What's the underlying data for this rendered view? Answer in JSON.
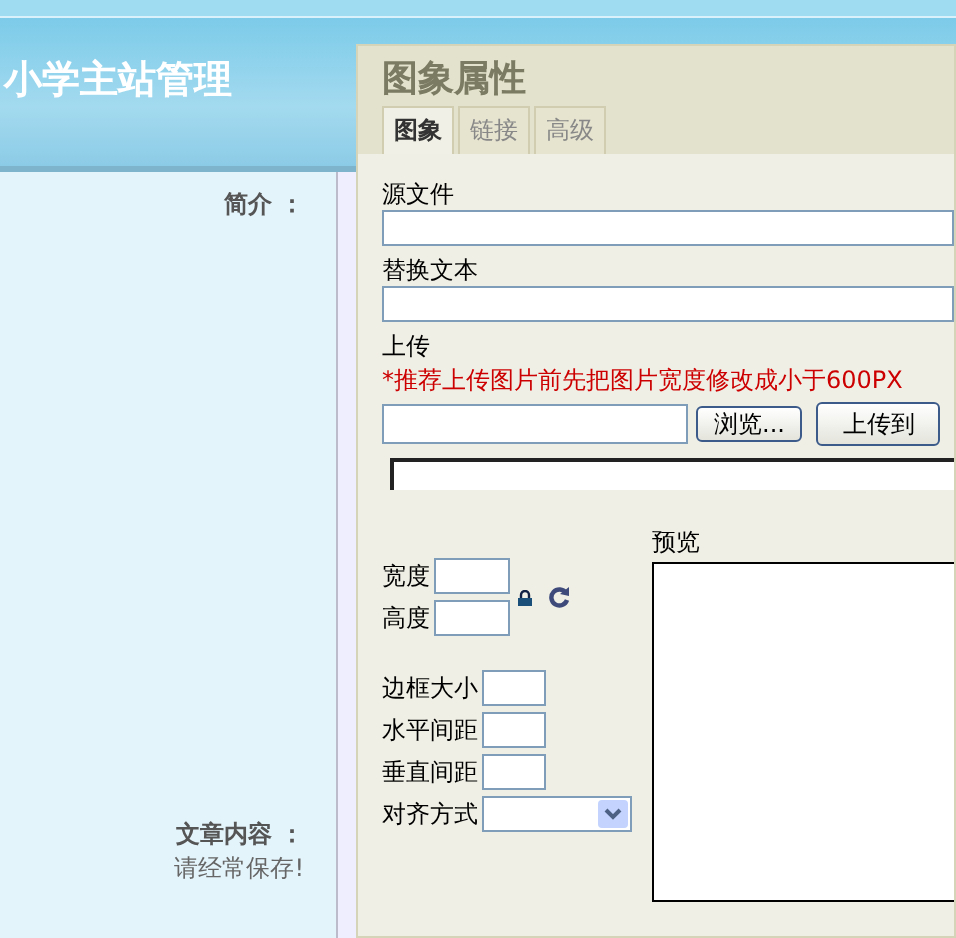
{
  "page": {
    "title": "小学主站管理",
    "fields": [
      {
        "label": "简介 ："
      },
      {
        "label": "文章内容 ：",
        "note": "请经常保存!"
      }
    ]
  },
  "dialog": {
    "title": "图象属性",
    "tabs": [
      {
        "label": "图象",
        "selected": true
      },
      {
        "label": "链接",
        "selected": false
      },
      {
        "label": "高级",
        "selected": false
      }
    ],
    "source_label": "源文件",
    "alt_label": "替换文本",
    "upload_label": "上传",
    "upload_hint": "*推荐上传图片前先把图片宽度修改成小于600PX",
    "browse_button": "浏览...",
    "upload_button": "上传到",
    "width_label": "宽度",
    "height_label": "高度",
    "spacing_fields": [
      {
        "label": "边框大小"
      },
      {
        "label": "水平间距"
      },
      {
        "label": "垂直间距"
      }
    ],
    "align_label": "对齐方式",
    "preview_label": "预览"
  }
}
